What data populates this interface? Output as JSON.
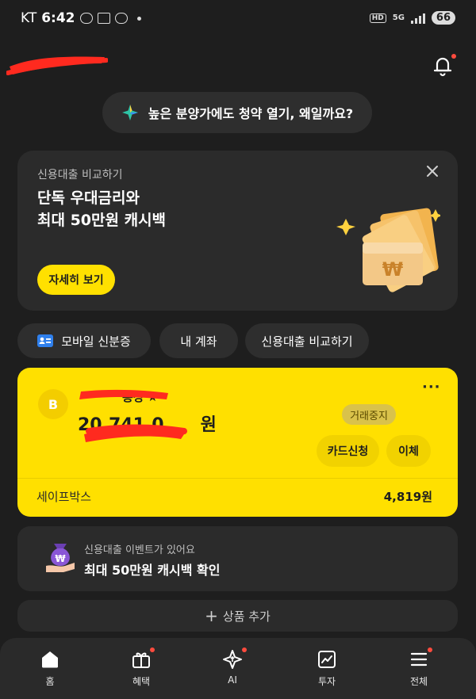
{
  "status_bar": {
    "carrier": "KT",
    "time": "6:42",
    "talk_icon_text": "TALK",
    "network_badge": "HD",
    "network_type": "5G",
    "battery": "66"
  },
  "header": {
    "bell_has_notification": true
  },
  "top_banner": {
    "text": "높은 분양가에도 청약 열기, 왜일까요?"
  },
  "promo_card": {
    "subtitle": "신용대출 비교하기",
    "title_line1": "단독 우대금리와",
    "title_line2": "최대 50만원 캐시백",
    "button_label": "자세히 보기",
    "currency_symbol": "₩"
  },
  "quick_chips": [
    {
      "label": "모바일 신분증"
    },
    {
      "label": "내 계좌"
    },
    {
      "label": "신용대출 비교하기"
    }
  ],
  "account_card": {
    "avatar_letter": "B",
    "name_suffix": "통장",
    "star": "★",
    "balance_visible": "20,741,0",
    "balance_suffix": "원",
    "more": "···",
    "status_badge": "거래중지",
    "card_apply_button": "카드신청",
    "transfer_button": "이체",
    "savebox_label": "세이프박스",
    "savebox_value": "4,819원"
  },
  "event_card": {
    "subtitle": "신용대출 이벤트가 있어요",
    "title": "최대 50만원 캐시백 확인",
    "currency_symbol": "₩"
  },
  "add_product": {
    "plus": "+",
    "label": "상품 추가"
  },
  "bottom_nav": [
    {
      "label": "홈",
      "icon": "home-icon",
      "badge": false
    },
    {
      "label": "혜택",
      "icon": "gift-icon",
      "badge": true
    },
    {
      "label": "AI",
      "icon": "ai-sparkle-icon",
      "badge": true
    },
    {
      "label": "투자",
      "icon": "chart-icon",
      "badge": false
    },
    {
      "label": "전체",
      "icon": "menu-icon",
      "badge": true
    }
  ],
  "colors": {
    "background": "#1e1e1e",
    "card": "#2b2b2b",
    "accent_yellow": "#ffe000",
    "redaction": "#ff2a1f",
    "notification_dot": "#ff4b3e"
  }
}
